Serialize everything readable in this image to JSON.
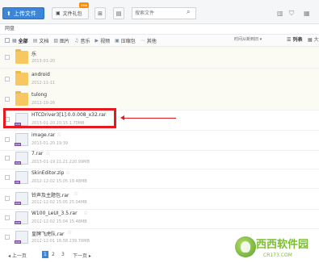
{
  "toolbar": {
    "upload_label": "上传文件",
    "gift_label": "文件礼包",
    "new_badge": "new",
    "search_placeholder": "搜索文件",
    "accent_color": "#3b86d9"
  },
  "breadcrumb": "网盘",
  "filters": {
    "all": "全部",
    "items": [
      "文档",
      "图片",
      "音乐",
      "视频",
      "压缩包",
      "其他"
    ],
    "sort_label": "时间从新到旧",
    "view_list": "列表",
    "view_grid": "大"
  },
  "files": [
    {
      "name": "乐",
      "meta": "2013-01-20",
      "type": "folder"
    },
    {
      "name": "android",
      "meta": "2012-11-11",
      "type": "folder"
    },
    {
      "name": "tulong",
      "meta": "2012-10-26",
      "type": "folder"
    },
    {
      "name": "HTCDriver3[1].0.0.008_x32.rar",
      "meta": "2013-01-20 20:15   1.70MB",
      "type": "rar"
    },
    {
      "name": "image.rar",
      "meta": "2013-01-20 19:39",
      "type": "rar"
    },
    {
      "name": "7.rar",
      "meta": "2013-01-19 21:21   220.99MB",
      "type": "rar"
    },
    {
      "name": "SkinEditor.zip",
      "meta": "2012-12-02 15:05   19.48MB",
      "type": "zip"
    },
    {
      "name": "铃声及主题包.rar",
      "meta": "2012-12-02 15:05   25.04MB",
      "type": "rar"
    },
    {
      "name": "W100_LeUI_3.5.rar",
      "meta": "2012-12-02 15:04   15.48MB",
      "type": "rar"
    },
    {
      "name": "皇牌飞虎队.rar",
      "meta": "2012-12-01 16:58   239.76MB",
      "type": "rar"
    }
  ],
  "pager": {
    "prev": "上一页",
    "pages": [
      "1",
      "2",
      "3"
    ],
    "next": "下一页"
  },
  "watermark": {
    "text": "西西软件园",
    "url": "CR173.COM"
  }
}
